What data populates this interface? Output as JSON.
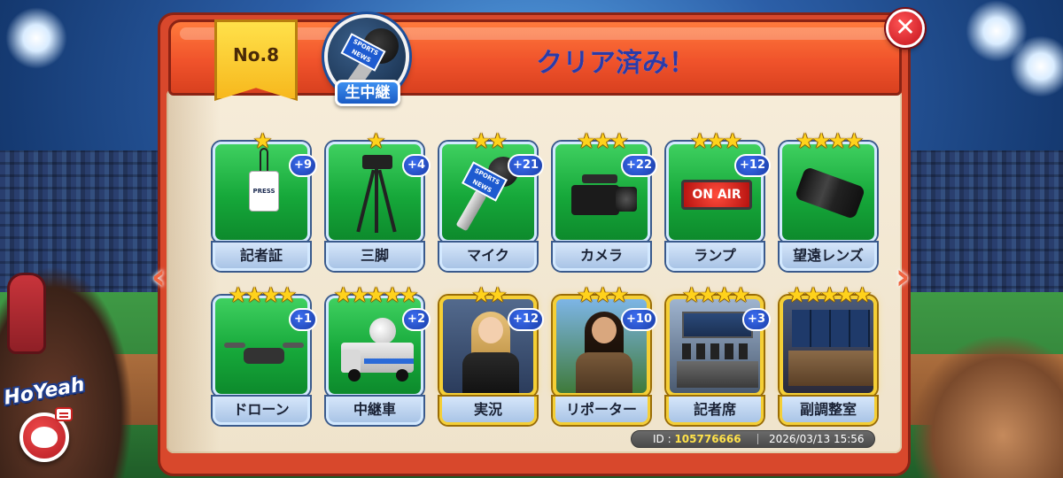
{
  "header": {
    "badge_number": "No.8",
    "medal_label": "生中継",
    "medal_flag": "SPORTS NEWS",
    "title": "クリア済み！",
    "close_glyph": "✕"
  },
  "nav": {
    "prev_glyph": "‹",
    "next_glyph": "›"
  },
  "cards": [
    {
      "label": "記者証",
      "stars": 1,
      "stars_text": "★",
      "count": "+9",
      "style": "green",
      "icon": "press-pass-icon",
      "press_text": "PRESS"
    },
    {
      "label": "三脚",
      "stars": 1,
      "stars_text": "★",
      "count": "+4",
      "style": "green",
      "icon": "tripod-icon"
    },
    {
      "label": "マイク",
      "stars": 2,
      "stars_text": "★★",
      "count": "+21",
      "style": "green",
      "icon": "microphone-icon",
      "flag_text": "SPORTS NEWS"
    },
    {
      "label": "カメラ",
      "stars": 3,
      "stars_text": "★★★",
      "count": "+22",
      "style": "green",
      "icon": "video-camera-icon"
    },
    {
      "label": "ランプ",
      "stars": 3,
      "stars_text": "★★★",
      "count": "+12",
      "style": "green",
      "icon": "on-air-lamp-icon",
      "lamp_text": "ON AIR"
    },
    {
      "label": "望遠レンズ",
      "stars": 4,
      "stars_text": "★★★★",
      "count": "",
      "style": "green",
      "icon": "telephoto-lens-icon"
    },
    {
      "label": "ドローン",
      "stars": 4,
      "stars_text": "★★★★",
      "count": "+1",
      "style": "green",
      "icon": "drone-icon"
    },
    {
      "label": "中継車",
      "stars": 5,
      "stars_text": "★★★★★",
      "count": "+2",
      "style": "green",
      "icon": "broadcast-truck-icon"
    },
    {
      "label": "実況",
      "stars": 2,
      "stars_text": "★★",
      "count": "+12",
      "style": "gold",
      "icon": "announcer-portrait"
    },
    {
      "label": "リポーター",
      "stars": 3,
      "stars_text": "★★★",
      "count": "+10",
      "style": "gold",
      "icon": "reporter-portrait"
    },
    {
      "label": "記者席",
      "stars": 4,
      "stars_text": "★★★★",
      "count": "+3",
      "style": "gold",
      "icon": "press-box-scene"
    },
    {
      "label": "副調整室",
      "stars": 5,
      "stars_text": "★★★★★",
      "count": "",
      "style": "gold",
      "icon": "control-room-scene"
    }
  ],
  "footer": {
    "id_label": "ID : ",
    "id_value": "105776666",
    "datetime": "2026/03/13 15:56"
  },
  "brand": {
    "logo_text": "HoYeah"
  },
  "colors": {
    "header": "#f0532b",
    "card_green": "#16a83a",
    "card_gold_border": "#f5cf35",
    "title_text": "#2b3aa8",
    "count_badge": "#1b3ea8"
  }
}
